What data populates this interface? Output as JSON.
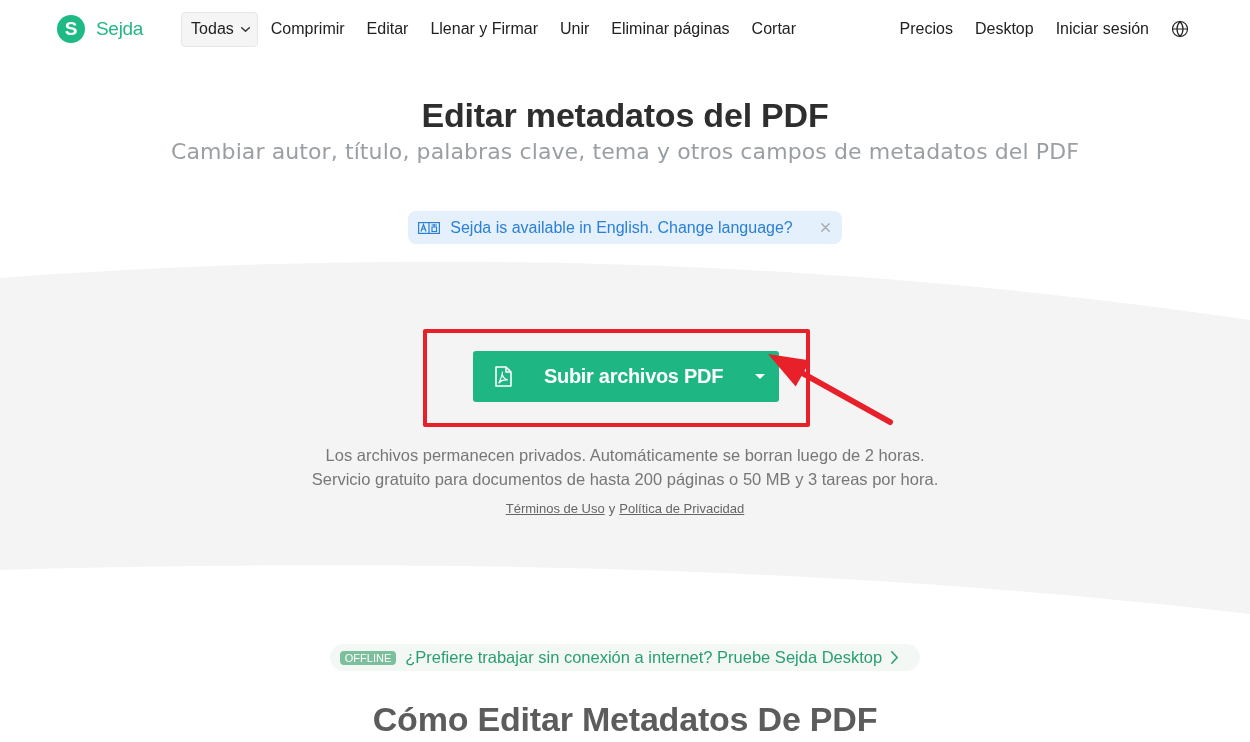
{
  "header": {
    "logo": {
      "mark": "S",
      "name": "Sejda"
    },
    "nav": [
      {
        "label": "Todas",
        "kind": "dropdown"
      },
      {
        "label": "Comprimir",
        "kind": "link"
      },
      {
        "label": "Editar",
        "kind": "link"
      },
      {
        "label": "Llenar y Firmar",
        "kind": "link"
      },
      {
        "label": "Unir",
        "kind": "link"
      },
      {
        "label": "Eliminar páginas",
        "kind": "link"
      },
      {
        "label": "Cortar",
        "kind": "link"
      }
    ],
    "account_nav": [
      "Precios",
      "Desktop",
      "Iniciar sesión"
    ]
  },
  "hero": {
    "title": "Editar metadatos del PDF",
    "subtitle": "Cambiar autor, título, palabras clave, tema y otros campos de metadatos del PDF"
  },
  "language_notice": {
    "text": "Sejda is available in English. Change language?"
  },
  "upload": {
    "button": "Subir archivos PDF",
    "notes": [
      "Los archivos permanecen privados. Automáticamente se borran luego de 2 horas.",
      "Servicio gratuito para documentos de hasta 200 páginas o 50 MB y 3 tareas por hora."
    ],
    "legal": {
      "links": [
        "Términos de Uso",
        "Política de Privacidad"
      ],
      "conjunction": "y"
    }
  },
  "offline_promo": {
    "badge": "OFFLINE",
    "text": "¿Prefiere trabajar sin conexión a internet? Pruebe Sejda Desktop"
  },
  "how_to": {
    "title": "Cómo Editar Metadatos De PDF"
  }
}
